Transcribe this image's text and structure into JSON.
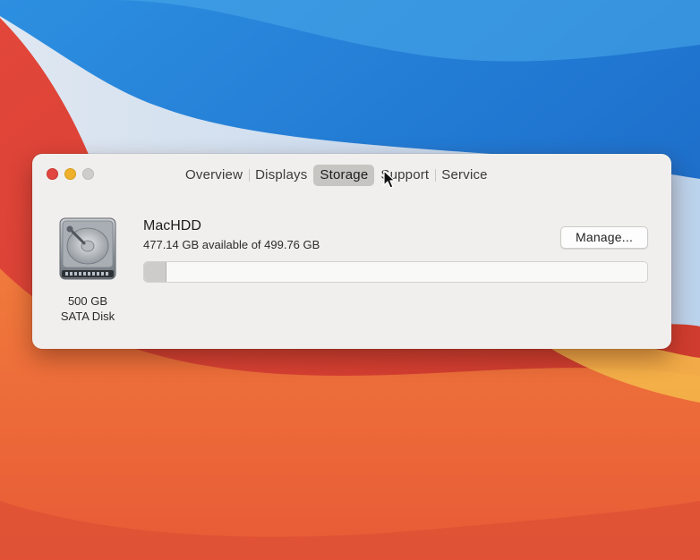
{
  "window": {
    "tabs": [
      {
        "label": "Overview"
      },
      {
        "label": "Displays"
      },
      {
        "label": "Storage"
      },
      {
        "label": "Support"
      },
      {
        "label": "Service"
      }
    ],
    "active_tab": "Storage"
  },
  "disk": {
    "size": "500 GB",
    "type": "SATA Disk"
  },
  "volume": {
    "name": "MacHDD",
    "available_text": "477.14 GB available of 499.76 GB",
    "used_fraction": 0.045
  },
  "buttons": {
    "manage_label": "Manage..."
  },
  "colors": {
    "close": "#e2473f",
    "minimize": "#efb12b",
    "zoom": "#cfcdca",
    "active_tab_bg": "#c7c5c2"
  }
}
